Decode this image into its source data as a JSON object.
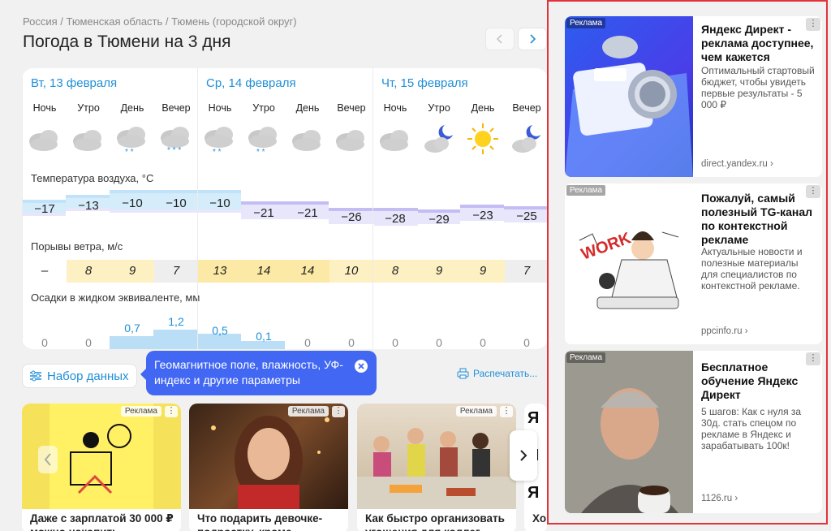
{
  "breadcrumbs": "Россия / Тюменская область / Тюмень (городской округ)",
  "page_title": "Погода в Тюмени на 3 дня",
  "days": [
    {
      "title": "Вт, 13 февраля",
      "periods": [
        "Ночь",
        "Утро",
        "День",
        "Вечер"
      ],
      "temps": [
        "−17",
        "−13",
        "−10",
        "−10"
      ],
      "wind": [
        "–",
        "8",
        "9",
        "7"
      ],
      "precip": [
        "0",
        "0",
        "0,7",
        "1,2"
      ]
    },
    {
      "title": "Ср, 14 февраля",
      "periods": [
        "Ночь",
        "Утро",
        "День",
        "Вечер"
      ],
      "temps": [
        "−10",
        "−21",
        "−21",
        "−26"
      ],
      "wind": [
        "13",
        "14",
        "14",
        "10"
      ],
      "precip": [
        "0,5",
        "0,1",
        "0",
        "0"
      ]
    },
    {
      "title": "Чт, 15 февраля",
      "periods": [
        "Ночь",
        "Утро",
        "День",
        "Вечер"
      ],
      "temps": [
        "−28",
        "−29",
        "−23",
        "−25"
      ],
      "wind": [
        "8",
        "9",
        "9",
        "7"
      ],
      "precip": [
        "0",
        "0",
        "0",
        "0"
      ]
    }
  ],
  "sections": {
    "temperature": "Температура воздуха, °С",
    "wind": "Порывы ветра, м/с",
    "precip": "Осадки в жидком эквиваленте, мм"
  },
  "dataset_button": "Набор данных",
  "tooltip_text": "Геомагнитное поле, влажность, УФ-индекс и другие параметры",
  "print_label": "Распечатать...",
  "ad_tag": "Реклама",
  "news": [
    {
      "title": "Даже с зарплатой 30 000 ₽ можно накопить"
    },
    {
      "title": "Что подарить девочке-подростку, кроме"
    },
    {
      "title": "Как быстро организовать угощения для коллег"
    },
    {
      "title": "Хо"
    }
  ],
  "ads": [
    {
      "title": "Яндекс Директ - реклама доступнее, чем кажется",
      "desc": "Оптимальный стартовый бюджет, чтобы увидеть первые результаты - 5 000 ₽",
      "source": "direct.yandex.ru"
    },
    {
      "title": "Пожалуй, самый полезный TG-канал по контекстной рекламе",
      "desc": "Актуальные новости и полезные материалы для специалистов по контекстной рекламе.",
      "source": "ppcinfo.ru",
      "image_text": "WORK"
    },
    {
      "title": "Бесплатное обучение Яндекс Директ",
      "desc": "5 шагов: Как с нуля за 30д. стать спецом по рекламе в Яндекс и зарабатывать 100к!",
      "source": "1126.ru"
    }
  ],
  "colors": {
    "accent": "#1f8fd8",
    "tooltip": "#4167f3",
    "ad_border": "#e3333a"
  }
}
